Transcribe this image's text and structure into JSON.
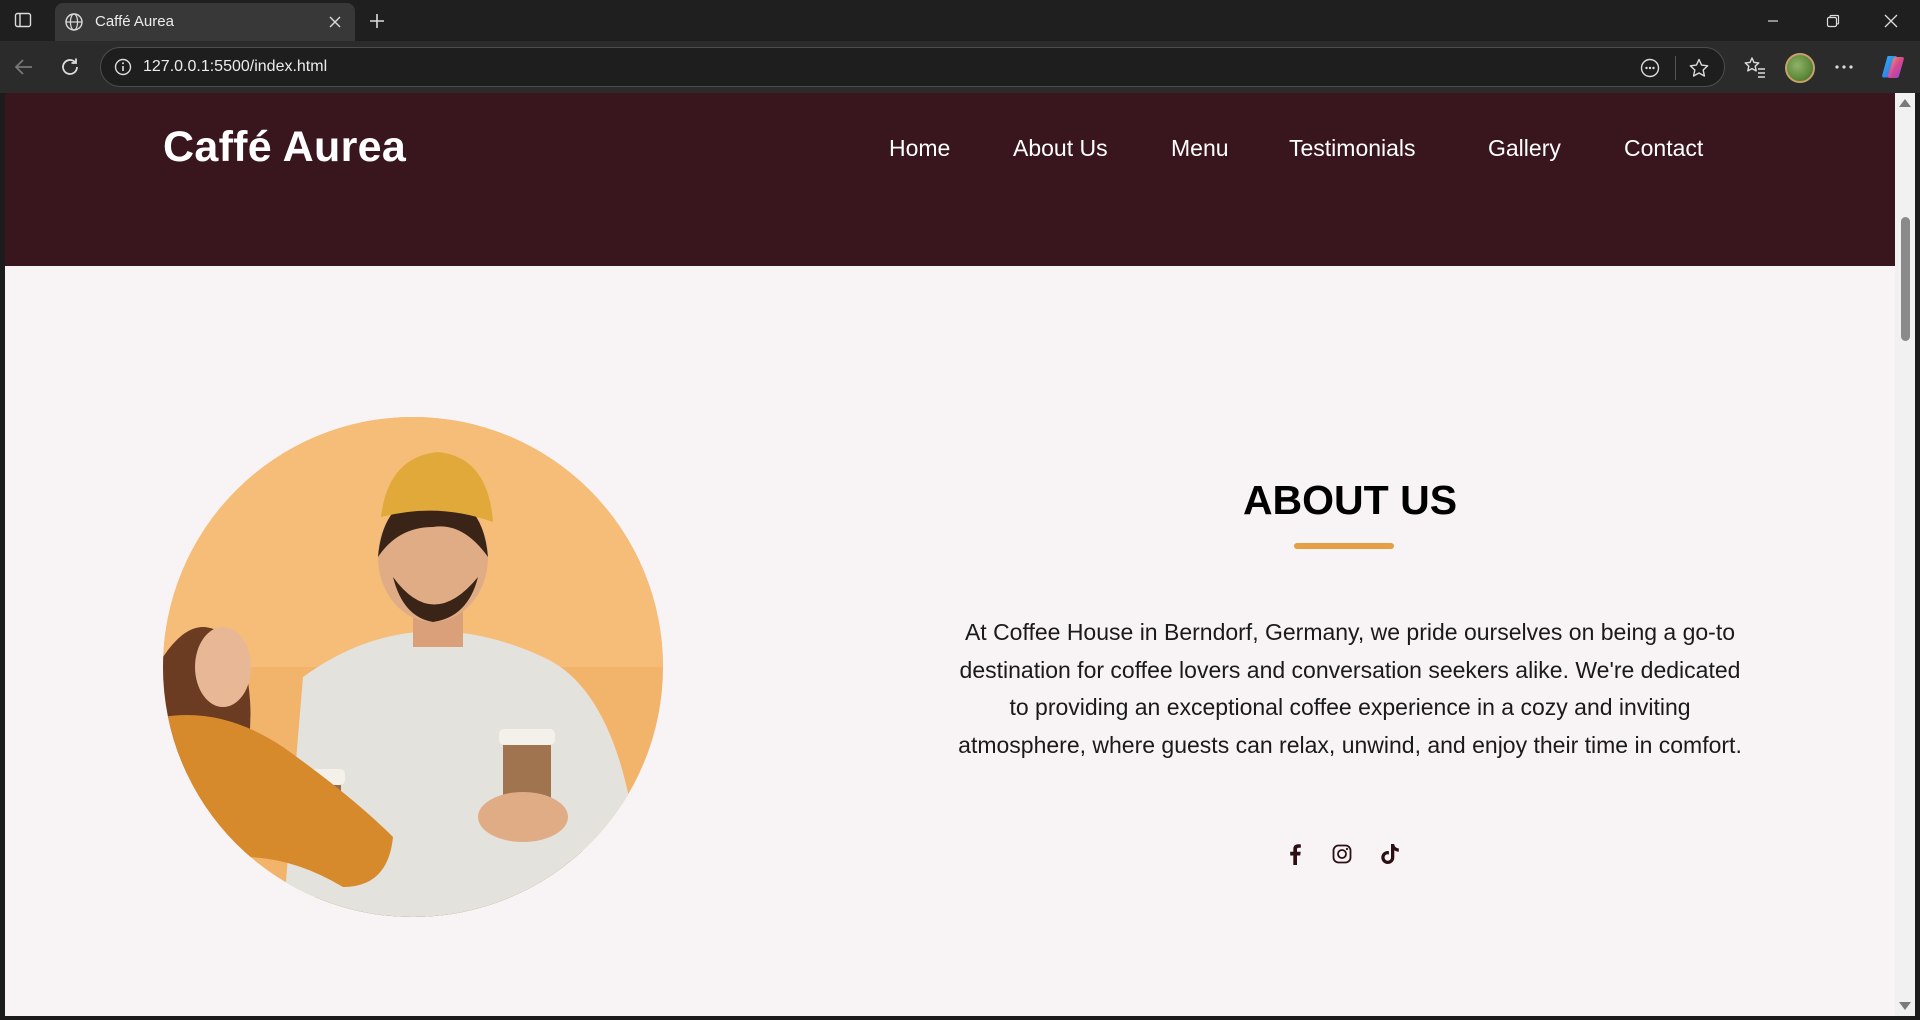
{
  "browser": {
    "tab_title": "Caffé Aurea",
    "url": "127.0.0.1:5500/index.html"
  },
  "site": {
    "logo": "Caffé Aurea",
    "nav": [
      {
        "label": "Home"
      },
      {
        "label": "About Us"
      },
      {
        "label": "Menu"
      },
      {
        "label": "Testimonials"
      },
      {
        "label": "Gallery"
      },
      {
        "label": "Contact"
      }
    ]
  },
  "about": {
    "title": "ABOUT US",
    "text": "At Coffee House in Berndorf, Germany, we pride ourselves on being a go-to destination for coffee lovers and conversation seekers alike. We're dedicated to providing an exceptional coffee experience in a cozy and inviting atmosphere, where guests can relax, unwind, and enjoy their time in comfort.",
    "socials": [
      "facebook-icon",
      "instagram-icon",
      "tiktok-icon"
    ]
  },
  "colors": {
    "header_bg": "#39151d",
    "accent": "#e5a045",
    "page_bg": "#f8f3f5"
  }
}
